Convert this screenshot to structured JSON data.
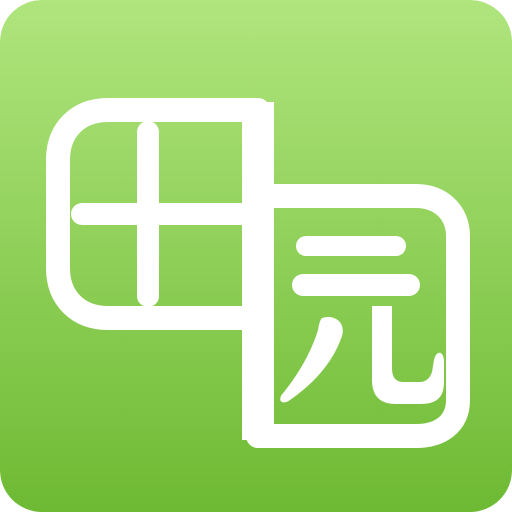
{
  "app_icon": {
    "characters": "田园",
    "icon_name": "tianyuan-app-icon",
    "colors": {
      "gradient_top": "#B0E57E",
      "gradient_bottom": "#6EBA33",
      "glyph": "#FFFFFF"
    }
  }
}
